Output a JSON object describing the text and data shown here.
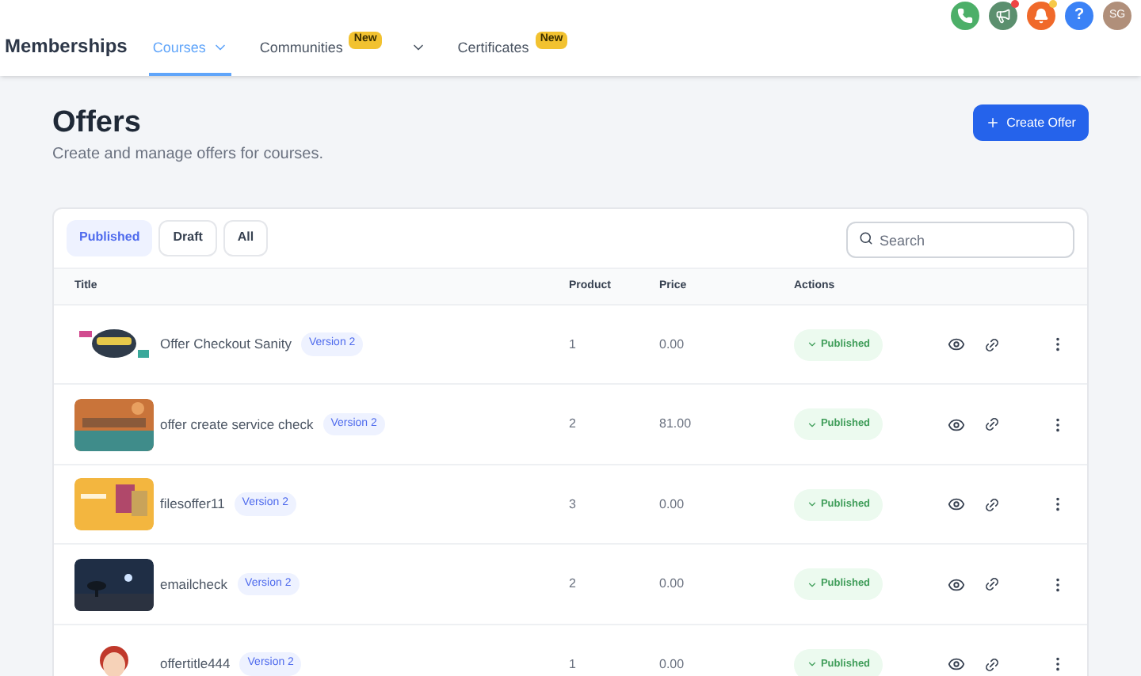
{
  "brand": "Memberships",
  "nav": [
    {
      "label": "Courses",
      "selected": true,
      "dropdown": true
    },
    {
      "label": "Communities",
      "selected": false,
      "badge": "New",
      "dropdown": true
    },
    {
      "label": "Certificates",
      "selected": false,
      "badge": "New",
      "dropdown": false
    }
  ],
  "header_icons": [
    {
      "kind": "phone",
      "color": "#4caf68"
    },
    {
      "kind": "megaphone",
      "color": "#5b8f6e",
      "dot": {
        "color": "#ef4444"
      }
    },
    {
      "kind": "bell",
      "color": "#f0692a",
      "dot": {
        "color": "#f7c948"
      }
    },
    {
      "kind": "help",
      "color": "#3b82f6",
      "label": "?"
    }
  ],
  "avatar": "SG",
  "page": {
    "title": "Offers",
    "subtitle": "Create and manage offers for courses.",
    "create_button": "Create Offer"
  },
  "filters": [
    {
      "label": "Published",
      "selected": true
    },
    {
      "label": "Draft",
      "selected": false
    },
    {
      "label": "All",
      "selected": false
    }
  ],
  "search": {
    "placeholder": "Search"
  },
  "columns": [
    "Title",
    "Product",
    "Price",
    "Actions"
  ],
  "rows": [
    {
      "title": "Offer Checkout Sanity",
      "badge": "Version 2",
      "product": "1",
      "price": "0.00",
      "status": "Published"
    },
    {
      "title": "offer create service check",
      "badge": "Version 2",
      "product": "2",
      "price": "81.00",
      "status": "Published"
    },
    {
      "title": "filesoffer11",
      "badge": "Version 2",
      "product": "3",
      "price": "0.00",
      "status": "Published"
    },
    {
      "title": "emailcheck",
      "badge": "Version 2",
      "product": "2",
      "price": "0.00",
      "status": "Published"
    },
    {
      "title": "offertitle444",
      "badge": "Version 2",
      "product": "1",
      "price": "0.00",
      "status": "Published"
    }
  ]
}
